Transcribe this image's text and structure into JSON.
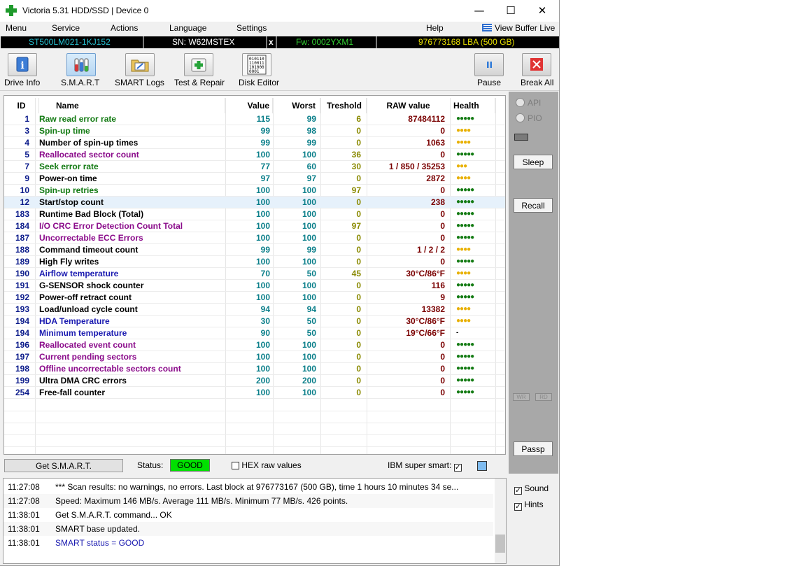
{
  "window": {
    "title": "Victoria 5.31 HDD/SSD | Device 0",
    "minimize": "—",
    "maximize": "☐",
    "close": "✕"
  },
  "menu": {
    "items": [
      "Menu",
      "Service",
      "Actions",
      "Language",
      "Settings",
      "Help"
    ],
    "view_buffer_live": "View Buffer Live"
  },
  "info_bar": {
    "model": "ST500LM021-1KJ152",
    "serial": "SN: W62MSTEX",
    "close_x": "x",
    "firmware": "Fw: 0002YXM1",
    "capacity": "976773168 LBA (500 GB)"
  },
  "toolbar": {
    "drive_info": "Drive Info",
    "smart": "S.M.A.R.T",
    "smart_logs": "SMART Logs",
    "test_repair": "Test & Repair",
    "disk_editor": "Disk Editor",
    "pause": "Pause",
    "break_all": "Break All"
  },
  "table": {
    "headers": {
      "id": "ID",
      "name": "Name",
      "value": "Value",
      "worst": "Worst",
      "threshold": "Treshold",
      "raw": "RAW value",
      "health": "Health"
    },
    "rows": [
      {
        "id": "1",
        "name": "Raw read error rate",
        "value": "115",
        "worst": "99",
        "threshold": "6",
        "raw": "87484112",
        "health": "●●●●●",
        "name_color": "#127a12",
        "health_color": "#127a12"
      },
      {
        "id": "3",
        "name": "Spin-up time",
        "value": "99",
        "worst": "98",
        "threshold": "0",
        "raw": "0",
        "health": "●●●●",
        "name_color": "#127a12",
        "health_color": "#e8b000"
      },
      {
        "id": "4",
        "name": "Number of spin-up times",
        "value": "99",
        "worst": "99",
        "threshold": "0",
        "raw": "1063",
        "health": "●●●●",
        "name_color": "#000000",
        "health_color": "#e8b000"
      },
      {
        "id": "5",
        "name": "Reallocated sector count",
        "value": "100",
        "worst": "100",
        "threshold": "36",
        "raw": "0",
        "health": "●●●●●",
        "name_color": "#8a0a8a",
        "health_color": "#127a12"
      },
      {
        "id": "7",
        "name": "Seek error rate",
        "value": "77",
        "worst": "60",
        "threshold": "30",
        "raw": "1 / 850 / 35253",
        "health": "●●●",
        "name_color": "#127a12",
        "health_color": "#e8b000"
      },
      {
        "id": "9",
        "name": "Power-on time",
        "value": "97",
        "worst": "97",
        "threshold": "0",
        "raw": "2872",
        "health": "●●●●",
        "name_color": "#000000",
        "health_color": "#e8b000"
      },
      {
        "id": "10",
        "name": "Spin-up retries",
        "value": "100",
        "worst": "100",
        "threshold": "97",
        "raw": "0",
        "health": "●●●●●",
        "name_color": "#127a12",
        "health_color": "#127a12"
      },
      {
        "id": "12",
        "name": "Start/stop count",
        "value": "100",
        "worst": "100",
        "threshold": "0",
        "raw": "238",
        "health": "●●●●●",
        "name_color": "#000000",
        "health_color": "#127a12"
      },
      {
        "id": "183",
        "name": "Runtime Bad Block (Total)",
        "value": "100",
        "worst": "100",
        "threshold": "0",
        "raw": "0",
        "health": "●●●●●",
        "name_color": "#000000",
        "health_color": "#127a12"
      },
      {
        "id": "184",
        "name": "I/O CRC Error Detection Count Total",
        "value": "100",
        "worst": "100",
        "threshold": "97",
        "raw": "0",
        "health": "●●●●●",
        "name_color": "#8a0a8a",
        "health_color": "#127a12"
      },
      {
        "id": "187",
        "name": "Uncorrectable ECC Errors",
        "value": "100",
        "worst": "100",
        "threshold": "0",
        "raw": "0",
        "health": "●●●●●",
        "name_color": "#8a0a8a",
        "health_color": "#127a12"
      },
      {
        "id": "188",
        "name": "Command timeout count",
        "value": "99",
        "worst": "99",
        "threshold": "0",
        "raw": "1 / 2 / 2",
        "health": "●●●●",
        "name_color": "#000000",
        "health_color": "#e8b000"
      },
      {
        "id": "189",
        "name": "High Fly writes",
        "value": "100",
        "worst": "100",
        "threshold": "0",
        "raw": "0",
        "health": "●●●●●",
        "name_color": "#000000",
        "health_color": "#127a12"
      },
      {
        "id": "190",
        "name": "Airflow temperature",
        "value": "70",
        "worst": "50",
        "threshold": "45",
        "raw": "30°C/86°F",
        "health": "●●●●",
        "name_color": "#1a1ab0",
        "health_color": "#e8b000"
      },
      {
        "id": "191",
        "name": "G-SENSOR shock counter",
        "value": "100",
        "worst": "100",
        "threshold": "0",
        "raw": "116",
        "health": "●●●●●",
        "name_color": "#000000",
        "health_color": "#127a12"
      },
      {
        "id": "192",
        "name": "Power-off retract count",
        "value": "100",
        "worst": "100",
        "threshold": "0",
        "raw": "9",
        "health": "●●●●●",
        "name_color": "#000000",
        "health_color": "#127a12"
      },
      {
        "id": "193",
        "name": "Load/unload cycle count",
        "value": "94",
        "worst": "94",
        "threshold": "0",
        "raw": "13382",
        "health": "●●●●",
        "name_color": "#000000",
        "health_color": "#e8b000"
      },
      {
        "id": "194",
        "name": "HDA Temperature",
        "value": "30",
        "worst": "50",
        "threshold": "0",
        "raw": "30°C/86°F",
        "health": "●●●●",
        "name_color": "#1a1ab0",
        "health_color": "#e8b000"
      },
      {
        "id": "194",
        "name": "Minimum temperature",
        "value": "90",
        "worst": "50",
        "threshold": "0",
        "raw": "19°C/66°F",
        "health": "-",
        "name_color": "#1a1ab0",
        "health_color": "#000000"
      },
      {
        "id": "196",
        "name": "Reallocated event count",
        "value": "100",
        "worst": "100",
        "threshold": "0",
        "raw": "0",
        "health": "●●●●●",
        "name_color": "#8a0a8a",
        "health_color": "#127a12"
      },
      {
        "id": "197",
        "name": "Current pending sectors",
        "value": "100",
        "worst": "100",
        "threshold": "0",
        "raw": "0",
        "health": "●●●●●",
        "name_color": "#8a0a8a",
        "health_color": "#127a12"
      },
      {
        "id": "198",
        "name": "Offline uncorrectable sectors count",
        "value": "100",
        "worst": "100",
        "threshold": "0",
        "raw": "0",
        "health": "●●●●●",
        "name_color": "#8a0a8a",
        "health_color": "#127a12"
      },
      {
        "id": "199",
        "name": "Ultra DMA CRC errors",
        "value": "200",
        "worst": "200",
        "threshold": "0",
        "raw": "0",
        "health": "●●●●●",
        "name_color": "#000000",
        "health_color": "#127a12"
      },
      {
        "id": "254",
        "name": "Free-fall counter",
        "value": "100",
        "worst": "100",
        "threshold": "0",
        "raw": "0",
        "health": "●●●●●",
        "name_color": "#000000",
        "health_color": "#127a12"
      }
    ]
  },
  "right_panel": {
    "api": "API",
    "pio": "PIO",
    "sleep": "Sleep",
    "recall": "Recall",
    "wr": "WR",
    "rd": "RD",
    "passp": "Passp"
  },
  "status": {
    "get_smart": "Get S.M.A.R.T.",
    "label": "Status:",
    "value": "GOOD",
    "hex_raw": "HEX raw values",
    "ibm": "IBM super smart:",
    "ibm_check": "✓"
  },
  "log": [
    {
      "time": "11:27:08",
      "msg": "*** Scan results: no warnings, no errors. Last block at 976773167 (500 GB), time 1 hours 10 minutes 34 se...",
      "color": "#000000"
    },
    {
      "time": "11:27:08",
      "msg": "Speed: Maximum 146 MB/s. Average 111 MB/s. Minimum 77 MB/s. 426 points.",
      "color": "#000000"
    },
    {
      "time": "11:38:01",
      "msg": "Get S.M.A.R.T. command... OK",
      "color": "#000000"
    },
    {
      "time": "11:38:01",
      "msg": "SMART base updated.",
      "color": "#000000"
    },
    {
      "time": "11:38:01",
      "msg": "SMART status = GOOD",
      "color": "#1a1ab0"
    }
  ],
  "bottom_right": {
    "sound": "Sound",
    "hints": "Hints",
    "check": "✓"
  },
  "colors": {
    "good": "#00e000",
    "info_model": "#26c0d0",
    "info_fw": "#33d433",
    "info_cap": "#e8e000"
  }
}
